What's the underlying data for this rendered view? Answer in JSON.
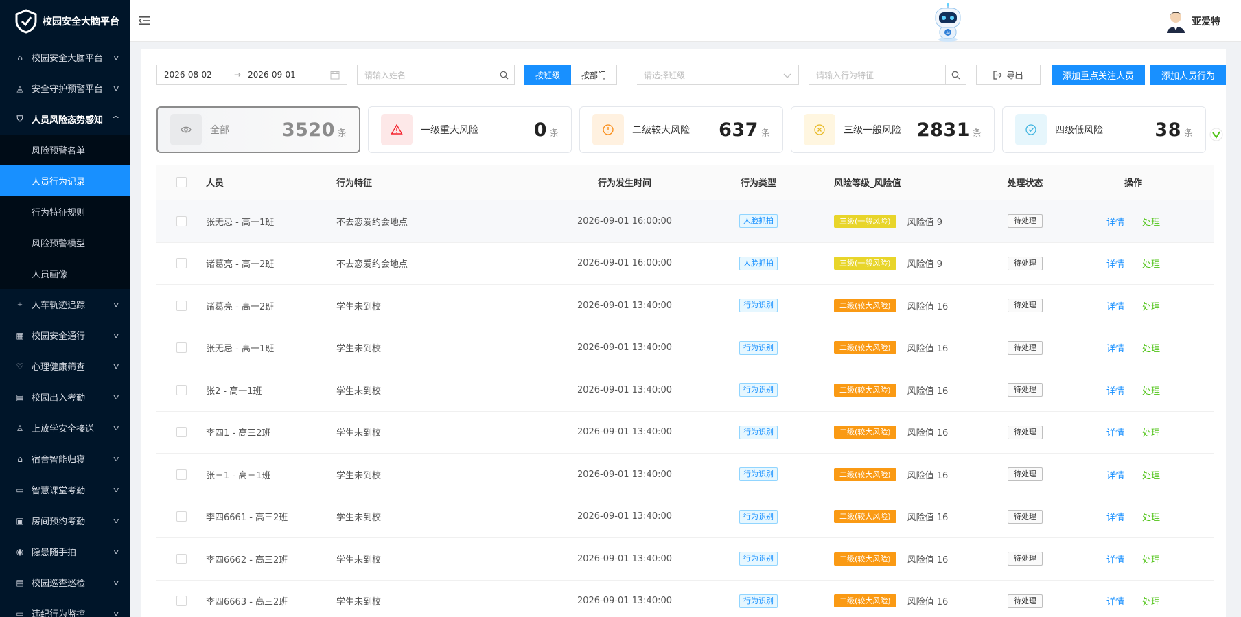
{
  "app": {
    "logo_text": "校园安全大脑平台"
  },
  "sidebar": {
    "menu_before": [
      {
        "label": "校园安全大脑平台",
        "icon": "home-icon"
      },
      {
        "label": "安全守护预警平台",
        "icon": "alarm-icon"
      }
    ],
    "open_menu": {
      "label": "人员风险态势感知",
      "icon": "shield-icon"
    },
    "submenu": [
      {
        "label": "风险预警名单",
        "active": false
      },
      {
        "label": "人员行为记录",
        "active": true
      },
      {
        "label": "行为特征规则",
        "active": false
      },
      {
        "label": "风险预警模型",
        "active": false
      },
      {
        "label": "人员画像",
        "active": false
      }
    ],
    "menu_after": [
      {
        "label": "人车轨迹追踪",
        "icon": "location-icon"
      },
      {
        "label": "校园安全通行",
        "icon": "grid-icon"
      },
      {
        "label": "心理健康筛查",
        "icon": "heart-icon"
      },
      {
        "label": "校园出入考勤",
        "icon": "calendar-icon"
      },
      {
        "label": "上放学安全接送",
        "icon": "user-icon"
      },
      {
        "label": "宿舍智能归寝",
        "icon": "building-icon"
      },
      {
        "label": "智慧课堂考勤",
        "icon": "board-icon"
      },
      {
        "label": "房间预约考勤",
        "icon": "room-icon"
      },
      {
        "label": "隐患随手拍",
        "icon": "camera-icon"
      },
      {
        "label": "校园巡查巡检",
        "icon": "check-icon"
      },
      {
        "label": "违纪行为监控",
        "icon": "monitor-icon"
      }
    ]
  },
  "topbar": {
    "username": "亚爱特"
  },
  "filters": {
    "date_start": "2026-08-02",
    "date_end": "2026-09-01",
    "name_placeholder": "请输入姓名",
    "by_class": "按班级",
    "by_dept": "按部门",
    "class_placeholder": "请选择班级",
    "behavior_placeholder": "请输入行为特征",
    "export": "导出",
    "add_focus": "添加重点关注人员",
    "add_behavior": "添加人员行为"
  },
  "stats": [
    {
      "label": "全部",
      "value": "3520",
      "unit": "条",
      "color": "#8c8c8c",
      "bg": "#e9eaec",
      "icon": "eye-icon",
      "selected": true
    },
    {
      "label": "一级重大风险",
      "value": "0",
      "unit": "条",
      "color": "#f5222d",
      "bg": "#fde8e8",
      "icon": "warning-icon",
      "selected": false
    },
    {
      "label": "二级较大风险",
      "value": "637",
      "unit": "条",
      "color": "#fa8c16",
      "bg": "#fff1e0",
      "icon": "exclamation-icon",
      "selected": false
    },
    {
      "label": "三级一般风险",
      "value": "2831",
      "unit": "条",
      "color": "#e8b923",
      "bg": "#fff6e0",
      "icon": "x-circle-icon",
      "selected": false
    },
    {
      "label": "四级低风险",
      "value": "38",
      "unit": "条",
      "color": "#3fb4e0",
      "bg": "#e6f6fc",
      "icon": "check-circle-icon",
      "selected": false
    }
  ],
  "table": {
    "headers": {
      "person": "人员",
      "feature": "行为特征",
      "time": "行为发生时间",
      "type": "行为类型",
      "risk": "风险等级_风险值",
      "state": "处理状态",
      "ops": "操作"
    },
    "detail_label": "详情",
    "handle_label": "处理",
    "rows": [
      {
        "person": "张无忌 - 高一1班",
        "feature": "不去恋爱约会地点",
        "time": "2026-09-01 16:00:00",
        "type": "人脸抓拍",
        "risk": "三级(一般风险)",
        "risk_level": 3,
        "risk_value": "风险值 9",
        "state": "待处理"
      },
      {
        "person": "诸葛亮 - 高一2班",
        "feature": "不去恋爱约会地点",
        "time": "2026-09-01 16:00:00",
        "type": "人脸抓拍",
        "risk": "三级(一般风险)",
        "risk_level": 3,
        "risk_value": "风险值 9",
        "state": "待处理"
      },
      {
        "person": "诸葛亮 - 高一2班",
        "feature": "学生未到校",
        "time": "2026-09-01 13:40:00",
        "type": "行为识别",
        "risk": "二级(较大风险)",
        "risk_level": 2,
        "risk_value": "风险值 16",
        "state": "待处理"
      },
      {
        "person": "张无忌 - 高一1班",
        "feature": "学生未到校",
        "time": "2026-09-01 13:40:00",
        "type": "行为识别",
        "risk": "二级(较大风险)",
        "risk_level": 2,
        "risk_value": "风险值 16",
        "state": "待处理"
      },
      {
        "person": "张2 - 高一1班",
        "feature": "学生未到校",
        "time": "2026-09-01 13:40:00",
        "type": "行为识别",
        "risk": "二级(较大风险)",
        "risk_level": 2,
        "risk_value": "风险值 16",
        "state": "待处理"
      },
      {
        "person": "李四1 - 高三2班",
        "feature": "学生未到校",
        "time": "2026-09-01 13:40:00",
        "type": "行为识别",
        "risk": "二级(较大风险)",
        "risk_level": 2,
        "risk_value": "风险值 16",
        "state": "待处理"
      },
      {
        "person": "张三1 - 高三1班",
        "feature": "学生未到校",
        "time": "2026-09-01 13:40:00",
        "type": "行为识别",
        "risk": "二级(较大风险)",
        "risk_level": 2,
        "risk_value": "风险值 16",
        "state": "待处理"
      },
      {
        "person": "李四6661 - 高三2班",
        "feature": "学生未到校",
        "time": "2026-09-01 13:40:00",
        "type": "行为识别",
        "risk": "二级(较大风险)",
        "risk_level": 2,
        "risk_value": "风险值 16",
        "state": "待处理"
      },
      {
        "person": "李四6662 - 高三2班",
        "feature": "学生未到校",
        "time": "2026-09-01 13:40:00",
        "type": "行为识别",
        "risk": "二级(较大风险)",
        "risk_level": 2,
        "risk_value": "风险值 16",
        "state": "待处理"
      },
      {
        "person": "李四6663 - 高三2班",
        "feature": "学生未到校",
        "time": "2026-09-01 13:40:00",
        "type": "行为识别",
        "risk": "二级(较大风险)",
        "risk_level": 2,
        "risk_value": "风险值 16",
        "state": "待处理"
      }
    ]
  }
}
